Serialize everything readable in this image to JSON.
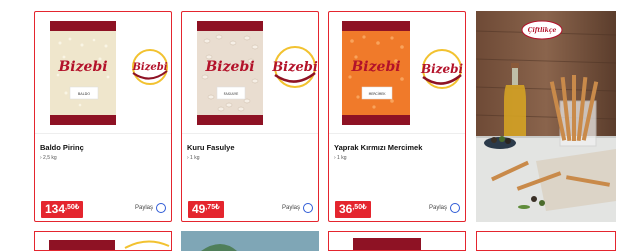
{
  "products": [
    {
      "name": "Baldo Pirinç",
      "weight": "› 2,5 kg",
      "price_int": "134",
      "price_dec": ",50",
      "currency": "₺",
      "share": "Paylaş",
      "brand": "Bizebi",
      "pack_label": "BALDO"
    },
    {
      "name": "Kuru Fasulye",
      "weight": "› 1 kg",
      "price_int": "49",
      "price_dec": ",75",
      "currency": "₺",
      "share": "Paylaş",
      "brand": "Bizebi",
      "pack_label": "FASULYE"
    },
    {
      "name": "Yaprak Kırmızı Mercimek",
      "weight": "› 1 kg",
      "price_int": "36",
      "price_dec": ",50",
      "currency": "₺",
      "share": "Paylaş",
      "brand": "Bizebi",
      "pack_label": "MERCİMEK"
    }
  ],
  "banner": {
    "logo": "Çiftlikçe"
  },
  "colors": {
    "accent": "#e4252e",
    "brand_red": "#b3122a",
    "brand_yellow": "#f2c230",
    "share_ring": "#2f5bd6"
  }
}
